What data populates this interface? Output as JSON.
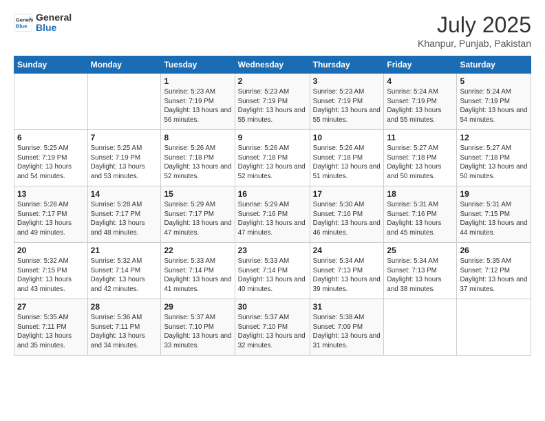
{
  "header": {
    "logo_general": "General",
    "logo_blue": "Blue",
    "month_year": "July 2025",
    "location": "Khanpur, Punjab, Pakistan"
  },
  "days_of_week": [
    "Sunday",
    "Monday",
    "Tuesday",
    "Wednesday",
    "Thursday",
    "Friday",
    "Saturday"
  ],
  "weeks": [
    [
      {
        "day": "",
        "info": ""
      },
      {
        "day": "",
        "info": ""
      },
      {
        "day": "1",
        "info": "Sunrise: 5:23 AM\nSunset: 7:19 PM\nDaylight: 13 hours and 56 minutes."
      },
      {
        "day": "2",
        "info": "Sunrise: 5:23 AM\nSunset: 7:19 PM\nDaylight: 13 hours and 55 minutes."
      },
      {
        "day": "3",
        "info": "Sunrise: 5:23 AM\nSunset: 7:19 PM\nDaylight: 13 hours and 55 minutes."
      },
      {
        "day": "4",
        "info": "Sunrise: 5:24 AM\nSunset: 7:19 PM\nDaylight: 13 hours and 55 minutes."
      },
      {
        "day": "5",
        "info": "Sunrise: 5:24 AM\nSunset: 7:19 PM\nDaylight: 13 hours and 54 minutes."
      }
    ],
    [
      {
        "day": "6",
        "info": "Sunrise: 5:25 AM\nSunset: 7:19 PM\nDaylight: 13 hours and 54 minutes."
      },
      {
        "day": "7",
        "info": "Sunrise: 5:25 AM\nSunset: 7:19 PM\nDaylight: 13 hours and 53 minutes."
      },
      {
        "day": "8",
        "info": "Sunrise: 5:26 AM\nSunset: 7:18 PM\nDaylight: 13 hours and 52 minutes."
      },
      {
        "day": "9",
        "info": "Sunrise: 5:26 AM\nSunset: 7:18 PM\nDaylight: 13 hours and 52 minutes."
      },
      {
        "day": "10",
        "info": "Sunrise: 5:26 AM\nSunset: 7:18 PM\nDaylight: 13 hours and 51 minutes."
      },
      {
        "day": "11",
        "info": "Sunrise: 5:27 AM\nSunset: 7:18 PM\nDaylight: 13 hours and 50 minutes."
      },
      {
        "day": "12",
        "info": "Sunrise: 5:27 AM\nSunset: 7:18 PM\nDaylight: 13 hours and 50 minutes."
      }
    ],
    [
      {
        "day": "13",
        "info": "Sunrise: 5:28 AM\nSunset: 7:17 PM\nDaylight: 13 hours and 49 minutes."
      },
      {
        "day": "14",
        "info": "Sunrise: 5:28 AM\nSunset: 7:17 PM\nDaylight: 13 hours and 48 minutes."
      },
      {
        "day": "15",
        "info": "Sunrise: 5:29 AM\nSunset: 7:17 PM\nDaylight: 13 hours and 47 minutes."
      },
      {
        "day": "16",
        "info": "Sunrise: 5:29 AM\nSunset: 7:16 PM\nDaylight: 13 hours and 47 minutes."
      },
      {
        "day": "17",
        "info": "Sunrise: 5:30 AM\nSunset: 7:16 PM\nDaylight: 13 hours and 46 minutes."
      },
      {
        "day": "18",
        "info": "Sunrise: 5:31 AM\nSunset: 7:16 PM\nDaylight: 13 hours and 45 minutes."
      },
      {
        "day": "19",
        "info": "Sunrise: 5:31 AM\nSunset: 7:15 PM\nDaylight: 13 hours and 44 minutes."
      }
    ],
    [
      {
        "day": "20",
        "info": "Sunrise: 5:32 AM\nSunset: 7:15 PM\nDaylight: 13 hours and 43 minutes."
      },
      {
        "day": "21",
        "info": "Sunrise: 5:32 AM\nSunset: 7:14 PM\nDaylight: 13 hours and 42 minutes."
      },
      {
        "day": "22",
        "info": "Sunrise: 5:33 AM\nSunset: 7:14 PM\nDaylight: 13 hours and 41 minutes."
      },
      {
        "day": "23",
        "info": "Sunrise: 5:33 AM\nSunset: 7:14 PM\nDaylight: 13 hours and 40 minutes."
      },
      {
        "day": "24",
        "info": "Sunrise: 5:34 AM\nSunset: 7:13 PM\nDaylight: 13 hours and 39 minutes."
      },
      {
        "day": "25",
        "info": "Sunrise: 5:34 AM\nSunset: 7:13 PM\nDaylight: 13 hours and 38 minutes."
      },
      {
        "day": "26",
        "info": "Sunrise: 5:35 AM\nSunset: 7:12 PM\nDaylight: 13 hours and 37 minutes."
      }
    ],
    [
      {
        "day": "27",
        "info": "Sunrise: 5:35 AM\nSunset: 7:11 PM\nDaylight: 13 hours and 35 minutes."
      },
      {
        "day": "28",
        "info": "Sunrise: 5:36 AM\nSunset: 7:11 PM\nDaylight: 13 hours and 34 minutes."
      },
      {
        "day": "29",
        "info": "Sunrise: 5:37 AM\nSunset: 7:10 PM\nDaylight: 13 hours and 33 minutes."
      },
      {
        "day": "30",
        "info": "Sunrise: 5:37 AM\nSunset: 7:10 PM\nDaylight: 13 hours and 32 minutes."
      },
      {
        "day": "31",
        "info": "Sunrise: 5:38 AM\nSunset: 7:09 PM\nDaylight: 13 hours and 31 minutes."
      },
      {
        "day": "",
        "info": ""
      },
      {
        "day": "",
        "info": ""
      }
    ]
  ]
}
